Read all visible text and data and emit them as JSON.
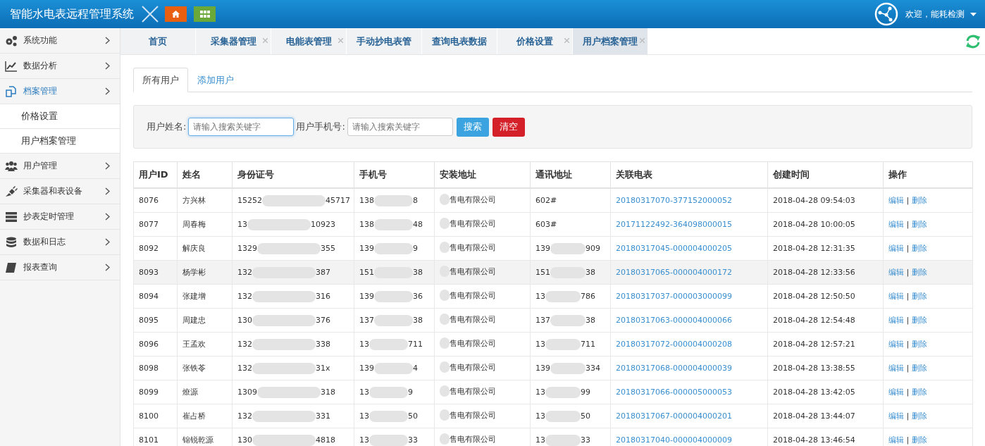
{
  "header": {
    "title": "智能水电表远程管理系统",
    "welcome": "欢迎，能耗检测"
  },
  "sidebar": {
    "items": [
      {
        "label": "系统功能",
        "selected": false
      },
      {
        "label": "数据分析",
        "selected": false
      },
      {
        "label": "档案管理",
        "selected": true,
        "children": [
          {
            "label": "价格设置"
          },
          {
            "label": "用户档案管理"
          }
        ]
      },
      {
        "label": "用户管理",
        "selected": false
      },
      {
        "label": "采集器和表设备",
        "selected": false
      },
      {
        "label": "抄表定时管理",
        "selected": false
      },
      {
        "label": "数据和日志",
        "selected": false
      },
      {
        "label": "报表查询",
        "selected": false
      }
    ]
  },
  "page_tabs": [
    {
      "label": "首页",
      "closable": false,
      "selected": false
    },
    {
      "label": "采集器管理",
      "closable": true,
      "selected": false
    },
    {
      "label": "电能表管理",
      "closable": true,
      "selected": false
    },
    {
      "label": "手动抄电表管",
      "closable": false,
      "selected": false
    },
    {
      "label": "查询电表数据",
      "closable": false,
      "selected": false
    },
    {
      "label": "价格设置",
      "closable": true,
      "selected": false
    },
    {
      "label": "用户档案管理",
      "closable": true,
      "selected": true
    }
  ],
  "sub_tabs": [
    {
      "label": "所有用户",
      "selected": true
    },
    {
      "label": "添加用户",
      "selected": false
    }
  ],
  "search": {
    "name_label": "用户姓名:",
    "name_placeholder": "请输入搜索关键字",
    "phone_label": "用户手机号:",
    "phone_placeholder": "请输入搜索关键字",
    "search_button": "搜索",
    "clear_button": "清空"
  },
  "table": {
    "columns": [
      "用户ID",
      "姓名",
      "身份证号",
      "手机号",
      "安装地址",
      "通讯地址",
      "关联电表",
      "创建时间",
      "操作"
    ],
    "rows": [
      {
        "id": "8076",
        "name": "方兴林",
        "idcard": {
          "head": "15252",
          "tail": "45717",
          "redacted": true
        },
        "phone": {
          "head": "138",
          "tail": "8",
          "redacted": true
        },
        "install": {
          "tail": "售电有限公司",
          "redacted": true
        },
        "comm": {
          "head": "602#",
          "redacted": false
        },
        "meter": "20180317070-377152000052",
        "created": "2018-04-28 09:54:03",
        "edit": "编辑",
        "sep": "|",
        "delete": "删除",
        "selected": false
      },
      {
        "id": "8077",
        "name": "周春梅",
        "idcard": {
          "head": "13",
          "tail": "10923",
          "redacted": true
        },
        "phone": {
          "head": "138",
          "tail": "48",
          "redacted": true
        },
        "install": {
          "tail": "售电有限公司",
          "redacted": true
        },
        "comm": {
          "head": "603#",
          "redacted": false
        },
        "meter": "20171122492-364098000015",
        "created": "2018-04-28 10:00:05",
        "edit": "编辑",
        "sep": "|",
        "delete": "删除",
        "selected": false
      },
      {
        "id": "8092",
        "name": "解庆良",
        "idcard": {
          "head": "1329",
          "tail": "355",
          "redacted": true
        },
        "phone": {
          "head": "139",
          "tail": "9",
          "redacted": true
        },
        "install": {
          "tail": "售电有限公司",
          "redacted": true
        },
        "comm": {
          "head": "139",
          "tail": "909",
          "redacted": true
        },
        "meter": "20180317045-000004000205",
        "created": "2018-04-28 12:31:35",
        "edit": "编辑",
        "sep": "|",
        "delete": "删除",
        "selected": false
      },
      {
        "id": "8093",
        "name": "杨学彬",
        "idcard": {
          "head": "132",
          "tail": "387",
          "redacted": true
        },
        "phone": {
          "head": "151",
          "tail": "38",
          "redacted": true
        },
        "install": {
          "tail": "售电有限公司",
          "redacted": true
        },
        "comm": {
          "head": "151",
          "tail": "38",
          "redacted": true
        },
        "meter": "20180317065-000004000172",
        "created": "2018-04-28 12:33:56",
        "edit": "编辑",
        "sep": "|",
        "delete": "删除",
        "selected": true
      },
      {
        "id": "8094",
        "name": "张建增",
        "idcard": {
          "head": "132",
          "tail": "316",
          "redacted": true
        },
        "phone": {
          "head": "139",
          "tail": "36",
          "redacted": true
        },
        "install": {
          "tail": "售电有限公司",
          "redacted": true
        },
        "comm": {
          "head": "13",
          "tail": "786",
          "redacted": true
        },
        "meter": "20180317037-000003000099",
        "created": "2018-04-28 12:50:50",
        "edit": "编辑",
        "sep": "|",
        "delete": "删除",
        "selected": false
      },
      {
        "id": "8095",
        "name": "周建忠",
        "idcard": {
          "head": "130",
          "tail": "376",
          "redacted": true
        },
        "phone": {
          "head": "137",
          "tail": "38",
          "redacted": true
        },
        "install": {
          "tail": "售电有限公司",
          "redacted": true
        },
        "comm": {
          "head": "137",
          "tail": "38",
          "redacted": true
        },
        "meter": "20180317063-000004000066",
        "created": "2018-04-28 12:54:48",
        "edit": "编辑",
        "sep": "|",
        "delete": "删除",
        "selected": false
      },
      {
        "id": "8096",
        "name": "王孟欢",
        "idcard": {
          "head": "132",
          "tail": "338",
          "redacted": true
        },
        "phone": {
          "head": "13",
          "tail": "711",
          "redacted": true
        },
        "install": {
          "tail": "售电有限公司",
          "redacted": true
        },
        "comm": {
          "head": "13",
          "tail": "711",
          "redacted": true
        },
        "meter": "20180317072-000004000208",
        "created": "2018-04-28 12:57:21",
        "edit": "编辑",
        "sep": "|",
        "delete": "删除",
        "selected": false
      },
      {
        "id": "8098",
        "name": "张铁苓",
        "idcard": {
          "head": "132",
          "tail": "31x",
          "redacted": true
        },
        "phone": {
          "head": "139",
          "tail": "4",
          "redacted": true
        },
        "install": {
          "tail": "售电有限公司",
          "redacted": true
        },
        "comm": {
          "head": "139",
          "tail": "334",
          "redacted": true
        },
        "meter": "20180317068-000004000039",
        "created": "2018-04-28 13:38:55",
        "edit": "编辑",
        "sep": "|",
        "delete": "删除",
        "selected": false
      },
      {
        "id": "8099",
        "name": "燎源",
        "idcard": {
          "head": "1309",
          "tail": "318",
          "redacted": true
        },
        "phone": {
          "head": "13",
          "tail": "9",
          "redacted": true
        },
        "install": {
          "tail": "售电有限公司",
          "redacted": true
        },
        "comm": {
          "head": "13",
          "tail": "99",
          "redacted": true
        },
        "meter": "20180317066-000005000053",
        "created": "2018-04-28 13:42:05",
        "edit": "编辑",
        "sep": "|",
        "delete": "删除",
        "selected": false
      },
      {
        "id": "8100",
        "name": "崔占桥",
        "idcard": {
          "head": "132",
          "tail": "331",
          "redacted": true
        },
        "phone": {
          "head": "13",
          "tail": "50",
          "redacted": true
        },
        "install": {
          "tail": "售电有限公司",
          "redacted": true
        },
        "comm": {
          "head": "13",
          "tail": "50",
          "redacted": true
        },
        "meter": "20180317067-000004000201",
        "created": "2018-04-28 13:44:07",
        "edit": "编辑",
        "sep": "|",
        "delete": "删除",
        "selected": false
      },
      {
        "id": "8101",
        "name": "锦锐乾源",
        "idcard": {
          "head": "130",
          "tail": "4818",
          "redacted": true
        },
        "phone": {
          "head": "13",
          "tail": "33",
          "redacted": true
        },
        "install": {
          "tail": "售电有限公司",
          "redacted": true
        },
        "comm": {
          "head": "13",
          "tail": "33",
          "redacted": true
        },
        "meter": "20180317040-000004000009",
        "created": "2018-04-28 13:46:54",
        "edit": "编辑",
        "sep": "|",
        "delete": "删除",
        "selected": false
      }
    ]
  }
}
